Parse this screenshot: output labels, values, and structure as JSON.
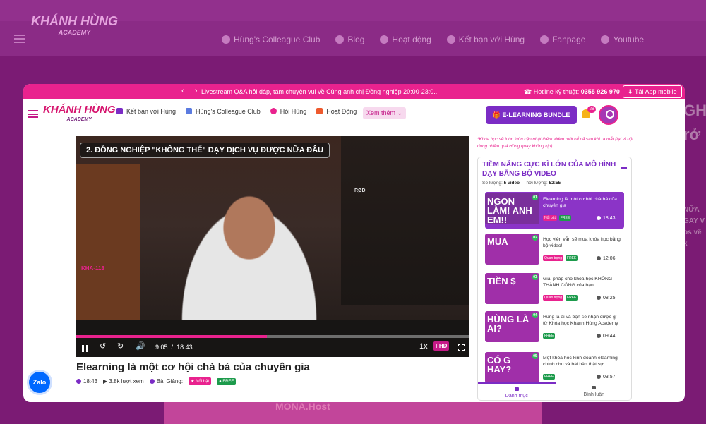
{
  "background": {
    "logo_main": "KHÁNH HÙNG",
    "logo_sub": "ACADEMY",
    "menu": [
      "Hùng's Colleague Club",
      "Blog",
      "Hoạt động",
      "Kết bạn với Hùng",
      "Fanpage",
      "Youtube"
    ],
    "right_text": [
      "GH",
      "rở"
    ],
    "right_small": [
      "NỮA",
      "GAY V",
      "os về k"
    ],
    "footer": "MONA.Host"
  },
  "topbar": {
    "arrows": "‹ ›",
    "announcement": "Livestream Q&A hỏi đáp, tám chuyện vui về Cùng anh chị Đồng nghiệp 20:00-23:0...",
    "hotline_label": "Hotline kỹ thuật:",
    "hotline_number": "0355 926 970",
    "app_button": "Tải App mobile"
  },
  "nav": {
    "logo_main": "KHÁNH HÙNG",
    "logo_sub": "ACADEMY",
    "items": [
      "Kết bạn với Hùng",
      "Hùng's Colleague Club",
      "Hỏi Hùng",
      "Hoạt Động"
    ],
    "see_more": "Xem thêm",
    "bundle_button": "E-LEARNING BUNDLE",
    "bell_count": "26"
  },
  "player": {
    "video_title": "2. ĐỒNG NGHIỆP \"KHÔNG THỂ\" DẠY DỊCH VỤ ĐƯỢC NỮA ĐÂU",
    "tag": "KHA-118",
    "mic_brand": "RØD",
    "current_time": "9:05",
    "separator": "/",
    "duration": "18:43",
    "progress": 0.485,
    "speed": "1x",
    "quality": "FHD"
  },
  "lesson": {
    "title": "Elearning là một cơ hội chà bá của chuyên gia",
    "duration": "18:43",
    "views": "3.8k lượt xem",
    "lesson_label": "Bài Giảng:",
    "badge_hot": "Nổi bật",
    "badge_free": "FREE"
  },
  "sidebar": {
    "note": "*Khóa học sẽ luôn luôn cập nhật thêm video mới kể cả sau khi ra mắt (tại vì nội dung nhiều quá Hùng quay không kịp)",
    "playlist_title": "TIỀM NĂNG CỰC KÌ LỚN CỦA MÔ HÌNH DẠY BẰNG BỘ VIDEO",
    "count_label": "Số lượng:",
    "count_value": "5 video",
    "length_label": "Thời lượng:",
    "length_value": "52:55",
    "items": [
      {
        "thumb": "NGON LÀM! ANH EM!!",
        "num": "01",
        "title": "Elearning là một cơ hội chà bá của chuyên gia",
        "tag1": "Nổi bật",
        "tag2": "FREE",
        "duration": "18:43"
      },
      {
        "thumb": "MUA",
        "num": "02",
        "title": "Học viên vẫn sẽ mua khóa học bằng bộ video!!",
        "tag1": "Quan trọng",
        "tag2": "FREE",
        "duration": "12:06"
      },
      {
        "thumb": "TIỀN $",
        "num": "03",
        "title": "Giải pháp cho khóa học KHÔNG THÀNH CÔNG của bạn",
        "tag1": "Quan trọng",
        "tag2": "FREE",
        "duration": "08:25"
      },
      {
        "thumb": "HÙNG LÀ AI?",
        "num": "04",
        "title": "Hùng là ai và bạn sẽ nhận được gì từ Khóa học Khánh Hùng Academy",
        "tag1": "",
        "tag2": "FREE",
        "duration": "09:44"
      },
      {
        "thumb": "CÓ G HAY?",
        "num": "05",
        "title": "Một khóa học kinh doanh elearning chính chu và bài bản thật sự",
        "tag1": "",
        "tag2": "FREE",
        "duration": "03:57"
      }
    ],
    "tab_list": "Danh mục",
    "tab_comments": "Bình luận"
  },
  "zalo": "Zalo",
  "colors": {
    "accent": "#e9228e",
    "purple": "#7b2cc5",
    "free": "#1d9b4c"
  }
}
